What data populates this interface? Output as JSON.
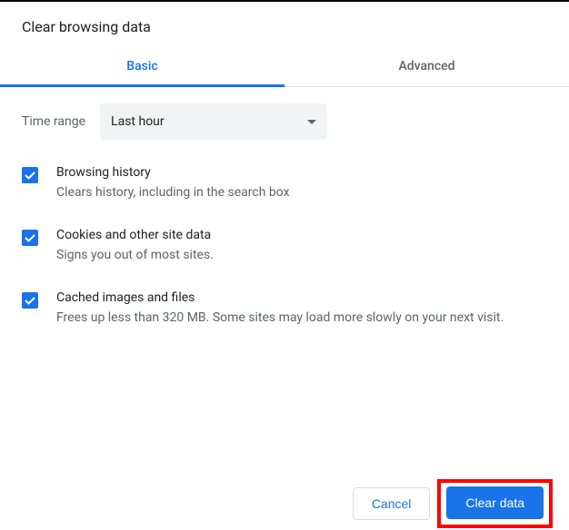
{
  "dialog": {
    "title": "Clear browsing data"
  },
  "tabs": {
    "basic": "Basic",
    "advanced": "Advanced"
  },
  "time": {
    "label": "Time range",
    "selected": "Last hour"
  },
  "options": {
    "browsing": {
      "title": "Browsing history",
      "desc": "Clears history, including in the search box"
    },
    "cookies": {
      "title": "Cookies and other site data",
      "desc": "Signs you out of most sites."
    },
    "cache": {
      "title": "Cached images and files",
      "desc": "Frees up less than 320 MB. Some sites may load more slowly on your next visit."
    }
  },
  "buttons": {
    "cancel": "Cancel",
    "clear": "Clear data"
  }
}
